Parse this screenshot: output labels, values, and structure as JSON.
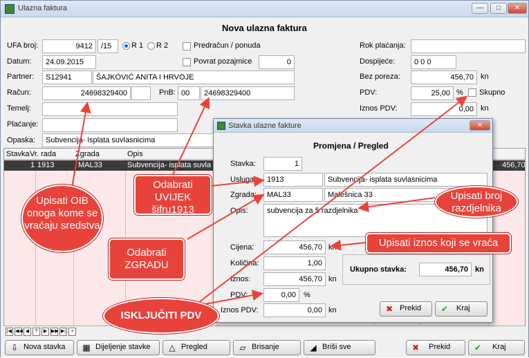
{
  "window": {
    "title": "Ulazna faktura",
    "min": "—",
    "max": "□",
    "close": "✕"
  },
  "form": {
    "heading": "Nova ulazna faktura",
    "ufa_label": "UFA broj:",
    "ufa_num": "9412",
    "ufa_suffix": "/15",
    "r1_label": "R 1",
    "r2_label": "R 2",
    "predracun_label": "Predračun / ponuda",
    "datum_label": "Datum:",
    "datum": "24.09.2015",
    "povrat_label": "Povrat pozajmice",
    "povrat_val": "0",
    "partner_label": "Partner:",
    "partner_code": "S12941",
    "partner_name": "ŠAJKOVIĆ ANITA I HRVOJE",
    "racun_label": "Račun:",
    "racun": "24698329400",
    "pnb_label": "PnB:",
    "pnb_model": "00",
    "pnb": "24698329400",
    "temelj_label": "Temelj:",
    "placanje_label": "Plaćanje:",
    "opaska_label": "Opaska:",
    "opaska": "Subvencija- isplata suvlasnicima",
    "rok_label": "Rok plaćanja:",
    "dospijece_label": "Dospijeće:",
    "dospijece": "0 0 0",
    "bez_poreza_label": "Bez poreza:",
    "bez_poreza": "456,70",
    "kn": "kn",
    "pdv_label": "PDV:",
    "pdv": "25,00",
    "pct": "%",
    "skupno_label": "Skupno",
    "iznos_pdv_label": "Iznos PDV:",
    "iznos_pdv": "0,00"
  },
  "grid": {
    "headers": [
      "Stavka",
      "Vr. rada",
      "Zgrada",
      "Opis"
    ],
    "row": {
      "stavka": "1",
      "vr_rada": "1913",
      "zgrada": "MAL33",
      "opis": "Subvencija- isplata suvla",
      "iznos": "456,70"
    }
  },
  "nav_buttons": [
    "|◀",
    "◀◀",
    "◀",
    "?",
    "▶",
    "▶▶",
    "▶|",
    "+"
  ],
  "toolbar": {
    "nova": "Nova stavka",
    "dijeljenje": "Dijeljenje stavke",
    "pregled": "Pregled",
    "brisanje": "Brisanje",
    "brisi_sve": "Briši sve",
    "prekid": "Prekid",
    "kraj": "Kraj"
  },
  "dialog": {
    "title": "Stavka ulazne fakture",
    "heading": "Promjena / Pregled",
    "stavka_label": "Stavka:",
    "stavka": "1",
    "usluga_label": "Usluga:",
    "usluga_code": "1913",
    "usluga_name": "Subvencija- isplata suvlasnicima",
    "zgrada_label": "Zgrada:",
    "zgrada_code": "MAL33",
    "zgrada_name": "Malešnica 33",
    "opis_label": "Opis:",
    "opis": "subvencija za 5 razdjelnika",
    "cijena_label": "Cijena:",
    "cijena": "456,70",
    "kolicina_label": "Količina:",
    "kolicina": "1,00",
    "iznos_label": "Iznos:",
    "iznos": "456,70",
    "pdv_label": "PDV:",
    "pdv": "0,00",
    "pct": "%",
    "iznos_pdv_label": "Iznos PDV:",
    "iznos_pdv": "0,00",
    "kn": "kn",
    "ukupno_label": "Ukupno stavka:",
    "ukupno": "456,70",
    "prekid": "Prekid",
    "kraj": "Kraj"
  },
  "callouts": {
    "oib": "Upisati OIB onoga kome se vraćaju sredstva",
    "uvijek": "Odabrati UVIJEK šifru1913",
    "zgradu": "Odabrati ZGRADU",
    "pdv": "ISKLJUČITI PDV",
    "razdjelnik": "Upisati broj razdjelnika",
    "iznos": "Upisati iznos koji se vraća"
  },
  "colors": {
    "callout": "#e8433b",
    "grid_row": "#3b3b3b",
    "grid_bg": "#fce8e8"
  }
}
